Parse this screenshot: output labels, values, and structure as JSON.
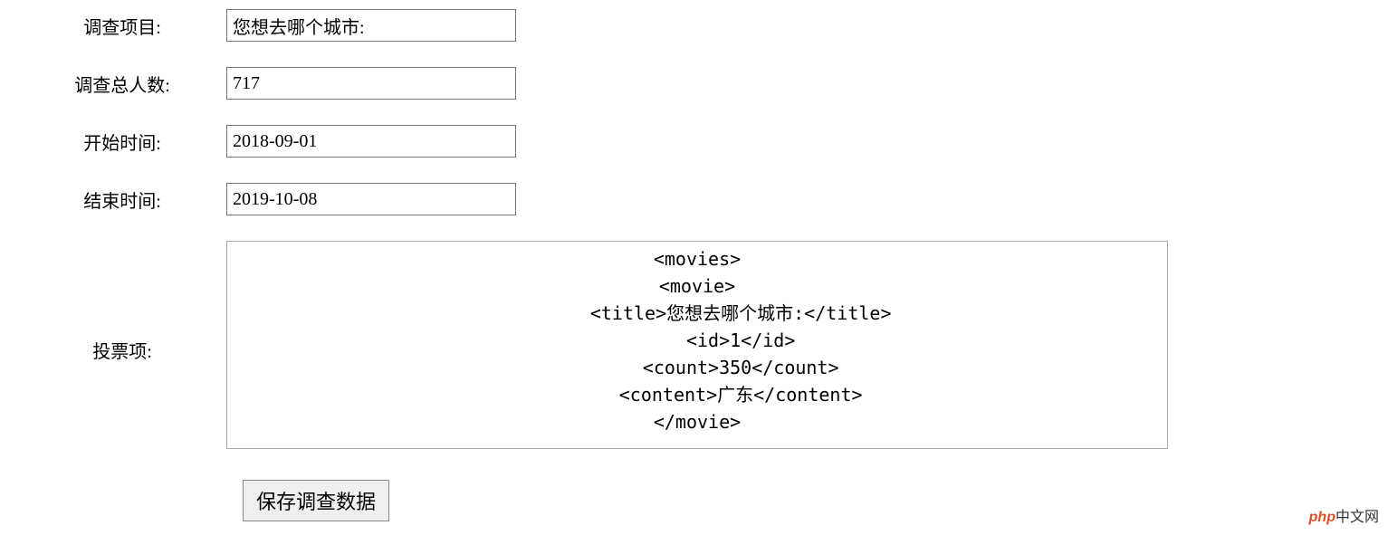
{
  "form": {
    "survey_item": {
      "label": "调查项目:",
      "value": "您想去哪个城市:"
    },
    "total_people": {
      "label": "调查总人数:",
      "value": "717"
    },
    "start_time": {
      "label": "开始时间:",
      "value": "2018-09-01"
    },
    "end_time": {
      "label": "结束时间:",
      "value": "2019-10-08"
    },
    "vote_items": {
      "label": "投票项:",
      "value": "<movies>\n<movie>\n        <title>您想去哪个城市:</title>\n        <id>1</id>\n        <count>350</count>\n        <content>广东</content>\n</movie>"
    },
    "save_button": "保存调查数据"
  },
  "watermark": {
    "brand": "php",
    "text": "中文网"
  }
}
